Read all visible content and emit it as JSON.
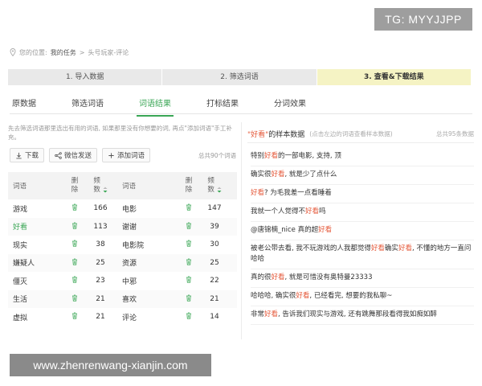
{
  "watermarks": {
    "top": "TG: MYYJJPP",
    "bottom": "www.zhenrenwang-xianjin.com"
  },
  "breadcrumb": {
    "prefix": "您的位置:",
    "current": "我的任务",
    "sep": ">",
    "tail": "头号玩家-评论"
  },
  "steps": [
    {
      "label": "1. 导入数据",
      "active": false
    },
    {
      "label": "2. 筛选词语",
      "active": false
    },
    {
      "label": "3. 查看&下载结果",
      "active": true
    }
  ],
  "tabs": [
    {
      "label": "原数据",
      "active": false
    },
    {
      "label": "筛选词语",
      "active": false
    },
    {
      "label": "词语结果",
      "active": true
    },
    {
      "label": "打标结果",
      "active": false
    },
    {
      "label": "分词效果",
      "active": false
    }
  ],
  "hint": "先去筛选词语那里选出有用的词语, 如果那里没有你想要的词, 再点\"添加词语\"手工补充。",
  "toolbar": {
    "download": "下载",
    "wechat": "微信发送",
    "add_word": "添加词语",
    "total": "总共90个词语"
  },
  "table": {
    "headers": {
      "word": "词语",
      "del_top": "删",
      "del_bottom": "除",
      "freq_top": "频",
      "freq_bottom": "数"
    },
    "rows": [
      {
        "w1": "游戏",
        "f1": "166",
        "w2": "电影",
        "f2": "147"
      },
      {
        "w1": "好看",
        "f1": "113",
        "w2": "谢谢",
        "f2": "39"
      },
      {
        "w1": "现实",
        "f1": "38",
        "w2": "电影院",
        "f2": "30"
      },
      {
        "w1": "嫌疑人",
        "f1": "25",
        "w2": "资源",
        "f2": "25"
      },
      {
        "w1": "僵灭",
        "f1": "23",
        "w2": "中邪",
        "f2": "22"
      },
      {
        "w1": "生活",
        "f1": "21",
        "w2": "喜欢",
        "f2": "21"
      },
      {
        "w1": "虚拟",
        "f1": "21",
        "w2": "评论",
        "f2": "14"
      }
    ]
  },
  "sample_panel": {
    "keyword": "\"好看\"",
    "title_suffix": "的样本数据",
    "note": "(点击左边的词语查看样本数据)",
    "total": "总共95条数据",
    "samples": [
      [
        {
          "t": "特别"
        },
        {
          "t": "好看",
          "hl": true
        },
        {
          "t": "的一部电影, 支持, 顶"
        }
      ],
      [
        {
          "t": "确实很"
        },
        {
          "t": "好看",
          "hl": true
        },
        {
          "t": ", 就是少了点什么"
        }
      ],
      [
        {
          "t": "好看",
          "hl": true
        },
        {
          "t": "? 为毛我差一点看睡着"
        }
      ],
      [
        {
          "t": "我就一个人觉得不"
        },
        {
          "t": "好看",
          "hl": true
        },
        {
          "t": "吗"
        }
      ],
      [
        {
          "t": "@唐锦楠_nice  真的超"
        },
        {
          "t": "好看",
          "hl": true
        }
      ],
      [
        {
          "t": "被老公带去看, 我不玩游戏的人我都觉得"
        },
        {
          "t": "好看",
          "hl": true
        },
        {
          "t": "确实"
        },
        {
          "t": "好看",
          "hl": true
        },
        {
          "t": ", 不懂的地方一直问哈哈"
        }
      ],
      [
        {
          "t": "真的很"
        },
        {
          "t": "好看",
          "hl": true
        },
        {
          "t": ", 就是可惜没有奥特曼23333"
        }
      ],
      [
        {
          "t": "哈哈哈, 确实很"
        },
        {
          "t": "好看",
          "hl": true
        },
        {
          "t": ", 已经看完, 想要的我私聊~"
        }
      ],
      [
        {
          "t": "非常"
        },
        {
          "t": "好看",
          "hl": true
        },
        {
          "t": ", 告诉我们现实与游戏, 还有跳舞那段看得我如痴如醉"
        }
      ]
    ]
  },
  "colors": {
    "accent_green": "#3aa655",
    "highlight_red": "#e55a3b",
    "active_step_bg": "#f5f3c4"
  }
}
